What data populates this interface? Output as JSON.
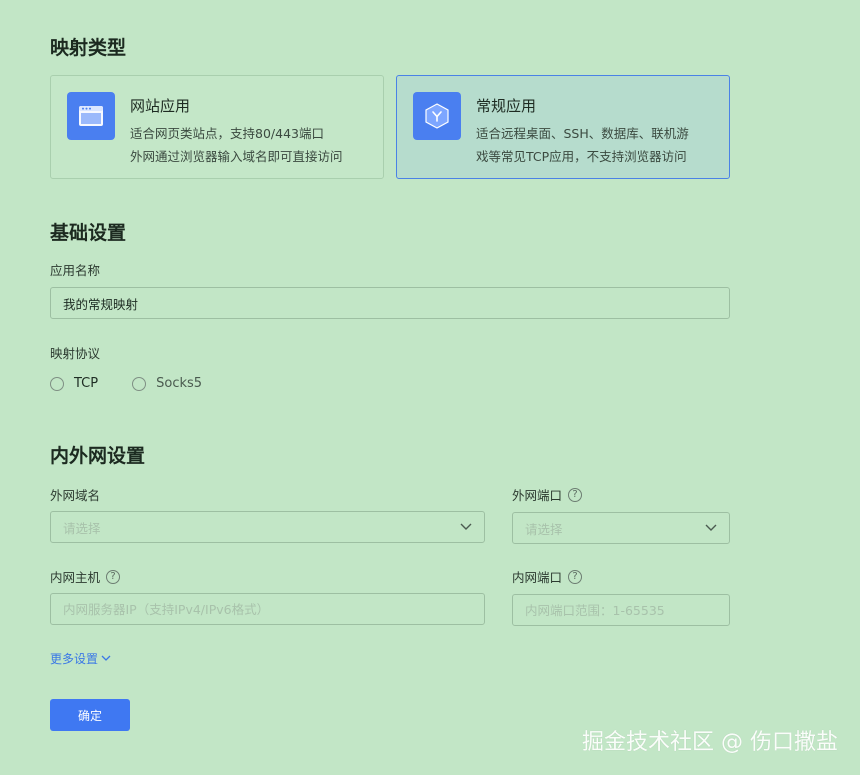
{
  "mapping_type": {
    "title": "映射类型",
    "cards": [
      {
        "title": "网站应用",
        "desc_line1": "适合网页类站点，支持80/443端口",
        "desc_line2": "外网通过浏览器输入域名即可直接访问",
        "icon": "browser-window-icon",
        "selected": false
      },
      {
        "title": "常规应用",
        "desc_line1": "适合远程桌面、SSH、数据库、联机游",
        "desc_line2": "戏等常见TCP应用，不支持浏览器访问",
        "icon": "cube-icon",
        "selected": true
      }
    ]
  },
  "basic": {
    "title": "基础设置",
    "app_name_label": "应用名称",
    "app_name_value": "我的常规映射",
    "protocol_label": "映射协议",
    "protocols": [
      "TCP",
      "Socks5"
    ]
  },
  "network": {
    "title": "内外网设置",
    "ext_domain_label": "外网域名",
    "ext_domain_placeholder": "请选择",
    "ext_port_label": "外网端口",
    "ext_port_placeholder": "请选择",
    "int_host_label": "内网主机",
    "int_host_placeholder": "内网服务器IP（支持IPv4/IPv6格式）",
    "int_port_label": "内网端口",
    "int_port_placeholder": "内网端口范围：1-65535"
  },
  "more_settings": "更多设置",
  "confirm_label": "确定",
  "watermark": "掘金技术社区 @ 伤口撒盐",
  "colors": {
    "background": "#c2e6c6",
    "accent": "#3f78f2",
    "selected_border": "#4a82e6"
  }
}
